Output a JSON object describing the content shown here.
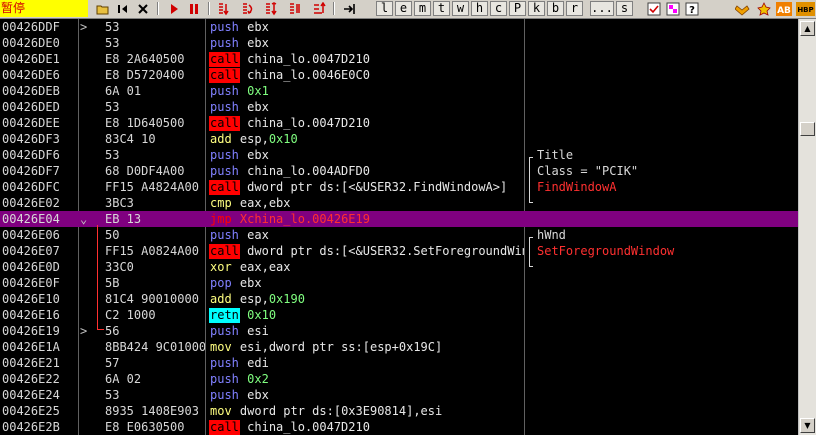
{
  "toolbar": {
    "status": "暂停",
    "letters": [
      "l",
      "e",
      "m",
      "t",
      "w",
      "h",
      "c",
      "P",
      "k",
      "b",
      "r",
      "...",
      "s"
    ]
  },
  "rows": [
    {
      "addr": "00426DDF",
      "mark": ">",
      "hex": "53",
      "mnem": "push",
      "ops": "ebx"
    },
    {
      "addr": "00426DE0",
      "mark": "",
      "hex": "53",
      "mnem": "push",
      "ops": "ebx"
    },
    {
      "addr": "00426DE1",
      "mark": "",
      "hex": "E8 2A640500",
      "mnem": "call",
      "ops": "china_lo.0047D210"
    },
    {
      "addr": "00426DE6",
      "mark": "",
      "hex": "E8 D5720400",
      "mnem": "call",
      "ops": "china_lo.0046E0C0"
    },
    {
      "addr": "00426DEB",
      "mark": "",
      "hex": "6A 01",
      "mnem": "push",
      "imm": "0x1"
    },
    {
      "addr": "00426DED",
      "mark": "",
      "hex": "53",
      "mnem": "push",
      "ops": "ebx"
    },
    {
      "addr": "00426DEE",
      "mark": "",
      "hex": "E8 1D640500",
      "mnem": "call",
      "ops": "china_lo.0047D210"
    },
    {
      "addr": "00426DF3",
      "mark": "",
      "hex": "83C4 10",
      "mnem": "add",
      "ops": "esp,",
      "imm": "0x10"
    },
    {
      "addr": "00426DF6",
      "mark": "",
      "hex": "53",
      "mnem": "push",
      "ops": "ebx",
      "cmt": "Title"
    },
    {
      "addr": "00426DF7",
      "mark": "",
      "hex": "68 D0DF4A00",
      "mnem": "push",
      "ops": "china_lo.004ADFD0",
      "cmt": "Class = \"PCIK\""
    },
    {
      "addr": "00426DFC",
      "mark": "",
      "hex": "FF15 A4824A00",
      "mnem": "call",
      "ops": "dword ptr ds:[<&USER32.FindWindowA>]",
      "cmt": "FindWindowA",
      "cmt_red": true
    },
    {
      "addr": "00426E02",
      "mark": "",
      "hex": "3BC3",
      "mnem": "cmp",
      "ops": "eax,ebx"
    },
    {
      "addr": "00426E04",
      "mark": "⌄",
      "hex": "EB 13",
      "mnem": "jmp",
      "jmp_ops": "Xchina_lo.00426E19",
      "selected": true
    },
    {
      "addr": "00426E06",
      "mark": "",
      "hex": "50",
      "mnem": "push",
      "ops": "eax",
      "cmt": "hWnd"
    },
    {
      "addr": "00426E07",
      "mark": "",
      "hex": "FF15 A0824A00",
      "mnem": "call",
      "ops": "dword ptr ds:[<&USER32.SetForegroundWindow>]",
      "cmt": "SetForegroundWindow",
      "cmt_red": true
    },
    {
      "addr": "00426E0D",
      "mark": "",
      "hex": "33C0",
      "mnem": "xor",
      "ops": "eax,eax"
    },
    {
      "addr": "00426E0F",
      "mark": "",
      "hex": "5B",
      "mnem": "pop",
      "ops": "ebx"
    },
    {
      "addr": "00426E10",
      "mark": "",
      "hex": "81C4 90010000",
      "mnem": "add",
      "ops": "esp,",
      "imm": "0x190"
    },
    {
      "addr": "00426E16",
      "mark": "",
      "hex": "C2 1000",
      "mnem": "retn",
      "imm": "0x10"
    },
    {
      "addr": "00426E19",
      "mark": ">",
      "hex": "56",
      "mnem": "push",
      "ops": "esi"
    },
    {
      "addr": "00426E1A",
      "mark": "",
      "hex": "8BB424 9C010000",
      "mnem": "mov",
      "ops": "esi,dword ptr ss:[esp+0x19C]"
    },
    {
      "addr": "00426E21",
      "mark": "",
      "hex": "57",
      "mnem": "push",
      "ops": "edi"
    },
    {
      "addr": "00426E22",
      "mark": "",
      "hex": "6A 02",
      "mnem": "push",
      "imm": "0x2"
    },
    {
      "addr": "00426E24",
      "mark": "",
      "hex": "53",
      "mnem": "push",
      "ops": "ebx"
    },
    {
      "addr": "00426E25",
      "mark": "",
      "hex": "8935 1408E903",
      "mnem": "mov",
      "ops": "dword ptr ds:[0x3E90814],esi"
    },
    {
      "addr": "00426E2B",
      "mark": "",
      "hex": "E8 E0630500",
      "mnem": "call",
      "ops": "china_lo.0047D210"
    }
  ]
}
